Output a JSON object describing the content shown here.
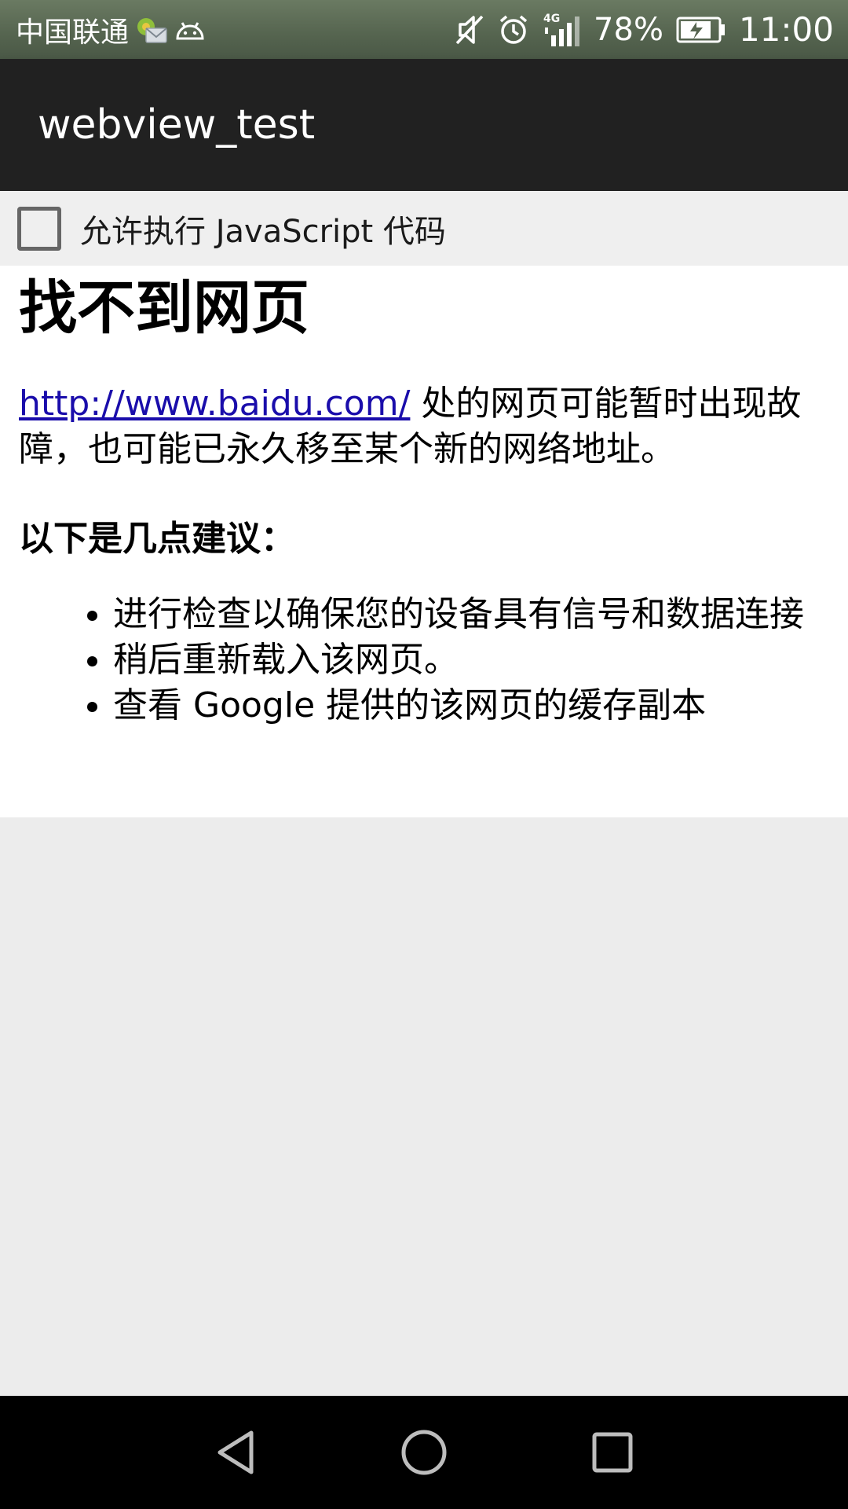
{
  "status_bar": {
    "carrier": "中国联通",
    "network": "4G",
    "battery_percent": "78%",
    "time": "11:00",
    "icons": [
      "mail-notification-icon",
      "android-icon",
      "mute-icon",
      "alarm-icon",
      "signal-icon",
      "battery-charging-icon"
    ]
  },
  "app_bar": {
    "title": "webview_test"
  },
  "option": {
    "checkbox_label": "允许执行 JavaScript 代码",
    "checked": false
  },
  "page": {
    "title": "找不到网页",
    "link": "http://www.baidu.com/",
    "desc_rest": " 处的网页可能暂时出现故障，也可能已永久移至某个新的网络地址。",
    "suggest_title": "以下是几点建议：",
    "suggestions": [
      "进行检查以确保您的设备具有信号和数据连接",
      "稍后重新载入该网页。",
      "查看 Google 提供的该网页的缓存副本"
    ]
  },
  "nav_bar": {
    "buttons": [
      "back-button",
      "home-button",
      "recents-button"
    ]
  }
}
